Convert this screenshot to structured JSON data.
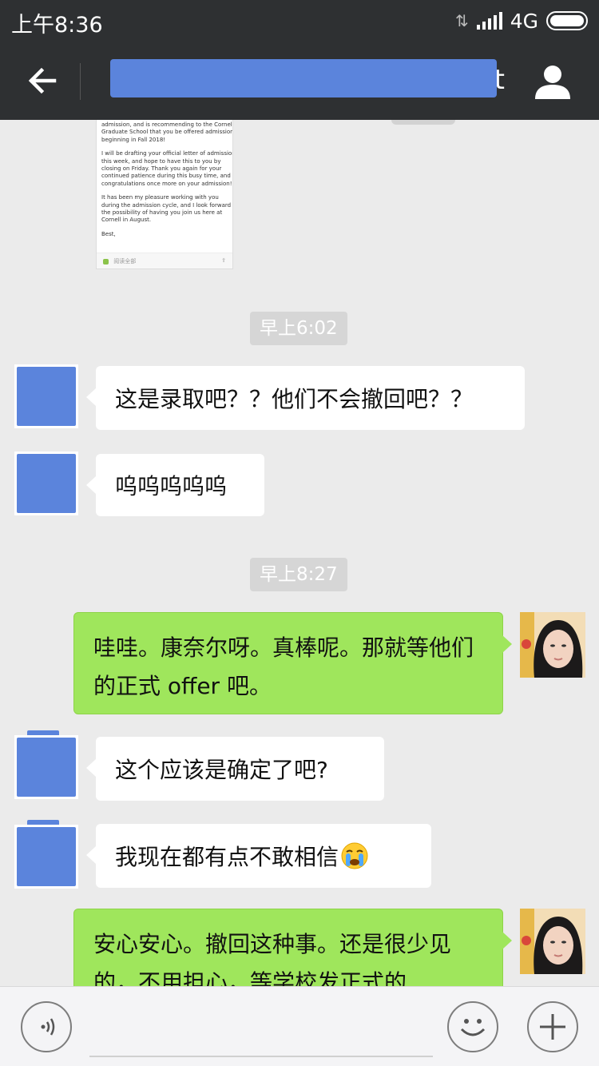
{
  "status_bar": {
    "time": "上午8:36",
    "network": "4G"
  },
  "nav": {
    "title": "t",
    "back_icon": "arrow-left-icon",
    "profile_icon": "person-icon"
  },
  "email_preview": {
    "lines": [
      "admission, and is recommending to the Cornell",
      "Graduate School that you be offered admission,",
      "beginning in Fall 2018!",
      "",
      "I will be drafting your official letter of admission",
      "this week, and hope to have this to you by",
      "closing on Friday.  Thank you again for your",
      "continued patience during this busy time, and",
      "congratulations once more on your admission!",
      "",
      "It has  been my pleasure working with you",
      "during the admission cycle, and I look forward to",
      "the possibility of having you join us here at",
      "Cornell in August.",
      "",
      "Best,"
    ],
    "footer": "阅读全部"
  },
  "messages": [
    {
      "type": "time",
      "text": "早上6:02"
    },
    {
      "type": "left",
      "text": "这是录取吧？？他们不会撤回吧？？"
    },
    {
      "type": "left",
      "text": "呜呜呜呜呜"
    },
    {
      "type": "time",
      "text": "早上8:27"
    },
    {
      "type": "right",
      "text": "哇哇。康奈尔呀。真棒呢。那就等他们的正式 offer 吧。"
    },
    {
      "type": "left",
      "text": "这个应该是确定了吧?"
    },
    {
      "type": "left",
      "text": "我现在都有点不敢相信",
      "emoji": "crying-face-icon"
    },
    {
      "type": "right",
      "text": "安心安心。撤回这种事。还是很少见的，不用担心，等学校发正式的"
    }
  ],
  "input_bar": {
    "voice_icon": "voice-icon",
    "emoji_icon": "smiley-icon",
    "plus_icon": "plus-icon"
  },
  "colors": {
    "header_bg": "#2e3032",
    "chat_bg": "#ebebeb",
    "self_bubble": "#9fe65c",
    "other_bubble": "#ffffff",
    "redaction": "#5b84dc",
    "timestamp_bg": "#d6d6d6"
  }
}
